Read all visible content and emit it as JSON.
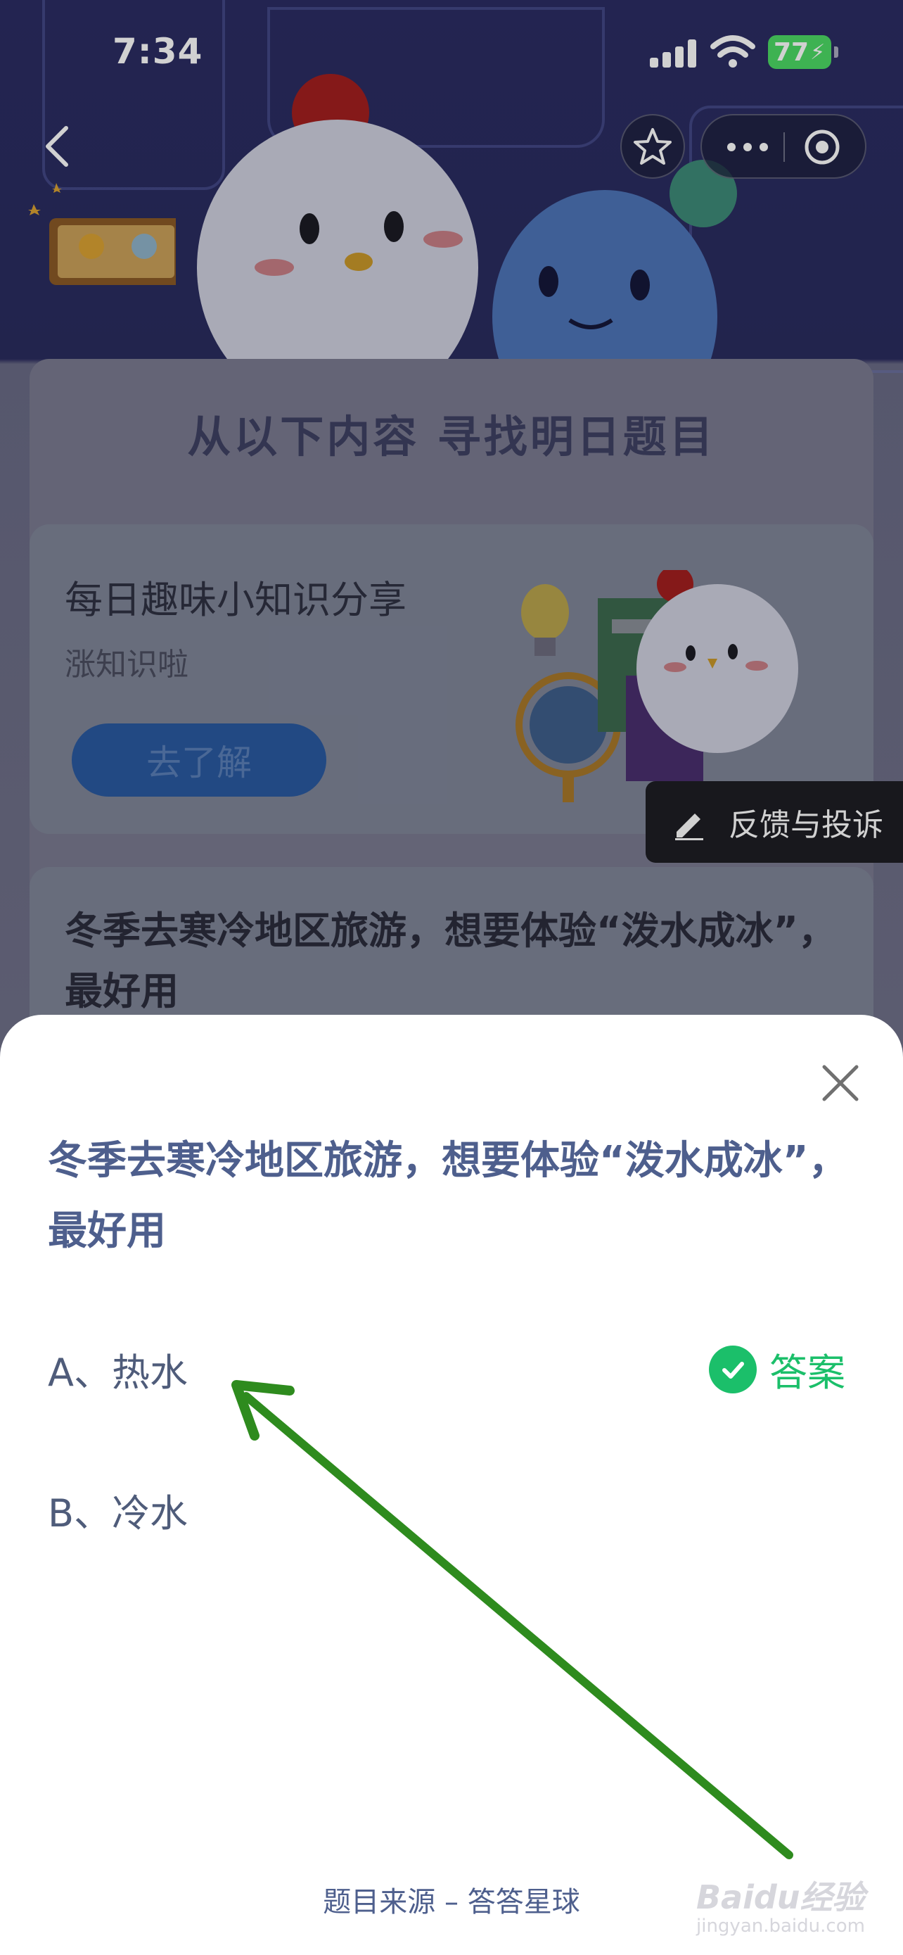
{
  "status_bar": {
    "time": "7:34",
    "battery": "77"
  },
  "nav": {
    "back_icon": "chevron-left-icon",
    "star_icon": "star-icon",
    "more_icon": "more-dots-icon",
    "target_icon": "target-icon"
  },
  "background_page": {
    "section_title": "从以下内容  寻找明日题目",
    "fact_card": {
      "title": "每日趣味小知识分享",
      "subtitle": "涨知识啦",
      "button": "去了解"
    },
    "question_card_text": "冬季去寒冷地区旅游，想要体验“泼水成冰”，最好用",
    "feedback_label": "反馈与投诉"
  },
  "sheet": {
    "question": "冬季去寒冷地区旅游，想要体验“泼水成冰”，最好用",
    "options": [
      {
        "label": "A、热水",
        "is_answer": true
      },
      {
        "label": "B、冷水",
        "is_answer": false
      }
    ],
    "answer_label": "答案",
    "source": "题目来源 – 答答星球"
  },
  "watermark": {
    "brand": "Baidu经验",
    "sub": "jingyan.baidu.com"
  },
  "colors": {
    "accent_green": "#1bbf6a",
    "question_blue": "#4e5f8d",
    "arrow_green": "#2e8b1e"
  }
}
